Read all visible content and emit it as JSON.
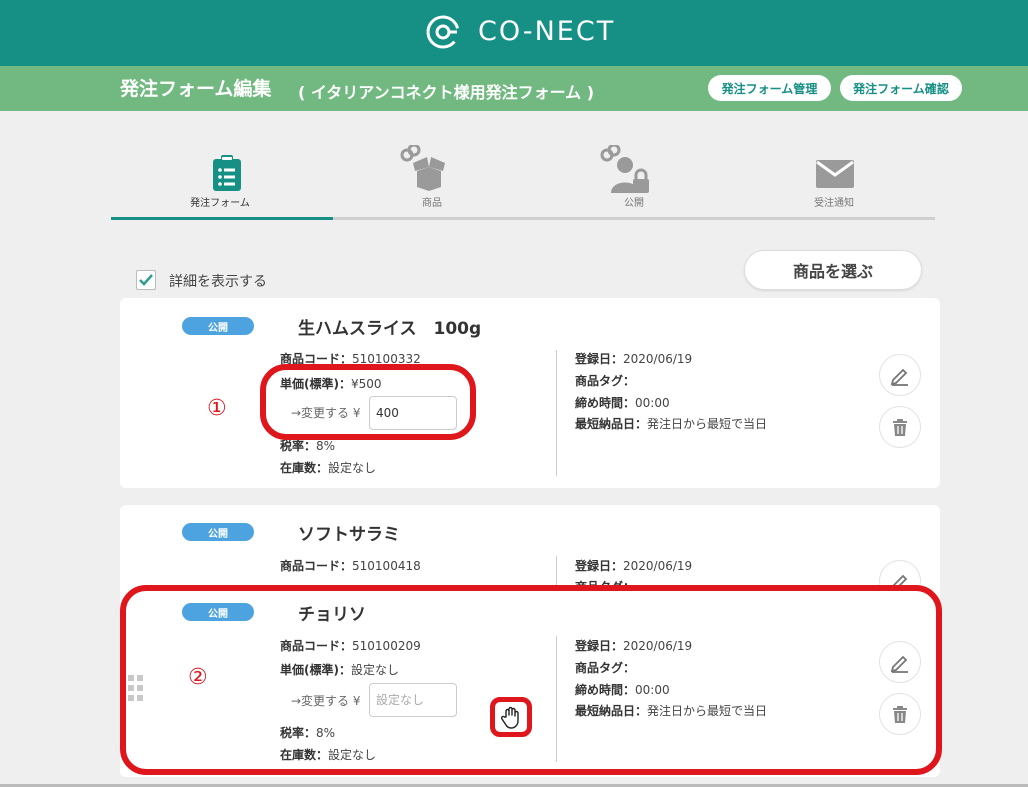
{
  "header": {
    "logo_text": "CO-NECT"
  },
  "subheader": {
    "title": "発注フォーム編集",
    "subtitle": "( イタリアンコネクト様用発注フォーム )",
    "btn_manage": "発注フォーム管理",
    "btn_confirm": "発注フォーム確認"
  },
  "steps": [
    {
      "label": "発注フォーム"
    },
    {
      "label": "商品"
    },
    {
      "label": "公開"
    },
    {
      "label": "受注通知"
    }
  ],
  "details": {
    "label": "詳細を表示する"
  },
  "select_button": "商品を選ぶ",
  "products": [
    {
      "badge": "公開",
      "name": "生ハムスライス　100g",
      "code_label": "商品コード：",
      "code": "510100332",
      "price_label": "単価(標準)：",
      "price": "¥500",
      "change_label": "→変更する ¥",
      "change_value": "400",
      "tax_label": "税率：",
      "tax": "8%",
      "stock_label": "在庫数：",
      "stock": "設定なし",
      "reg_label": "登録日：",
      "reg": "2020/06/19",
      "tag_label": "商品タグ：",
      "deadline_label": "締め時間：",
      "deadline": "00:00",
      "earliest_label": "最短納品日：",
      "earliest": "発注日から最短で当日"
    },
    {
      "badge": "公開",
      "name": "ソフトサラミ",
      "code_label": "商品コード：",
      "code": "510100418",
      "reg_label": "登録日：",
      "reg": "2020/06/19",
      "tag_label": "商品タグ："
    },
    {
      "badge": "公開",
      "name": "チョリソ",
      "code_label": "商品コード：",
      "code": "510100209",
      "price_label": "単価(標準)：",
      "price": "設定なし",
      "change_label": "→変更する ¥",
      "change_placeholder": "設定なし",
      "tax_label": "税率：",
      "tax": "8%",
      "stock_label": "在庫数：",
      "stock": "設定なし",
      "reg_label": "登録日：",
      "reg": "2020/06/19",
      "tag_label": "商品タグ：",
      "deadline_label": "締め時間：",
      "deadline": "00:00",
      "earliest_label": "最短納品日：",
      "earliest": "発注日から最短で当日"
    }
  ],
  "annotations": {
    "one": "①",
    "two": "②"
  },
  "colors": {
    "topbar": "#168f84",
    "subbar": "#72b981",
    "badge": "#4ca3e0",
    "annotation": "#e0161d"
  }
}
